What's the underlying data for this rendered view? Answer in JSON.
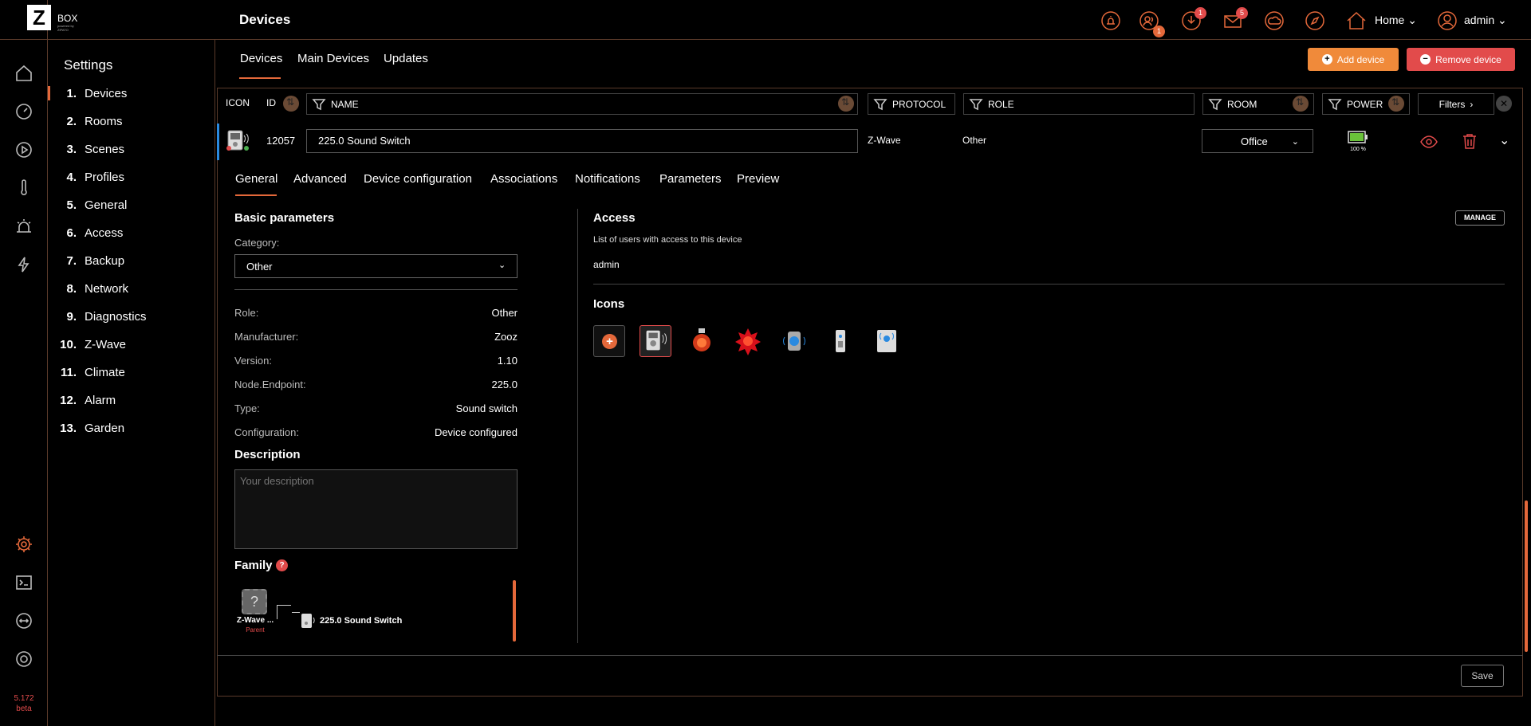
{
  "app": {
    "logo_text": "BOX",
    "logo_sub": "powered by ZIPATO",
    "version": "5.172",
    "version_tag": "beta"
  },
  "header": {
    "title": "Devices",
    "home_label": "Home",
    "user_label": "admin",
    "badges": {
      "users": "1",
      "downloads": "1",
      "messages": "5"
    }
  },
  "settings_nav": {
    "title": "Settings",
    "items": [
      {
        "num": "1.",
        "label": "Devices"
      },
      {
        "num": "2.",
        "label": "Rooms"
      },
      {
        "num": "3.",
        "label": "Scenes"
      },
      {
        "num": "4.",
        "label": "Profiles"
      },
      {
        "num": "5.",
        "label": "General"
      },
      {
        "num": "6.",
        "label": "Access"
      },
      {
        "num": "7.",
        "label": "Backup"
      },
      {
        "num": "8.",
        "label": "Network"
      },
      {
        "num": "9.",
        "label": "Diagnostics"
      },
      {
        "num": "10.",
        "label": "Z-Wave"
      },
      {
        "num": "11.",
        "label": "Climate"
      },
      {
        "num": "12.",
        "label": "Alarm"
      },
      {
        "num": "13.",
        "label": "Garden"
      }
    ]
  },
  "sub_tabs": [
    "Devices",
    "Main Devices",
    "Updates"
  ],
  "actions": {
    "add": "Add device",
    "remove": "Remove device"
  },
  "filters": {
    "icon": "ICON",
    "id": "ID",
    "name": "NAME",
    "protocol": "PROTOCOL",
    "role": "ROLE",
    "room": "ROOM",
    "power": "POWER",
    "filters_btn": "Filters"
  },
  "device": {
    "id": "12057",
    "name": "225.0 Sound Switch",
    "protocol": "Z-Wave",
    "role": "Other",
    "room": "Office",
    "battery": "100 %"
  },
  "detail_tabs": [
    "General",
    "Advanced",
    "Device configuration",
    "Associations",
    "Notifications",
    "Parameters",
    "Preview"
  ],
  "basic": {
    "title": "Basic parameters",
    "category_label": "Category:",
    "category_value": "Other",
    "rows": [
      {
        "label": "Role:",
        "value": "Other"
      },
      {
        "label": "Manufacturer:",
        "value": "Zooz"
      },
      {
        "label": "Version:",
        "value": "1.10"
      },
      {
        "label": "Node.Endpoint:",
        "value": "225.0"
      },
      {
        "label": "Type:",
        "value": "Sound switch"
      },
      {
        "label": "Configuration:",
        "value": "Device configured"
      }
    ]
  },
  "description": {
    "title": "Description",
    "placeholder": "Your description"
  },
  "family": {
    "title": "Family",
    "parent_name": "Z-Wave ...",
    "parent_tag": "Parent",
    "child_name": "225.0 Sound Switch"
  },
  "access": {
    "title": "Access",
    "manage": "MANAGE",
    "subtitle": "List of users with access to this device",
    "users": [
      "admin"
    ]
  },
  "icons_section": {
    "title": "Icons"
  },
  "footer": {
    "save": "Save"
  },
  "colors": {
    "accent": "#e4683a",
    "danger": "#e24b4b",
    "add": "#f08a3a",
    "selected_row": "#2a8ae0"
  }
}
